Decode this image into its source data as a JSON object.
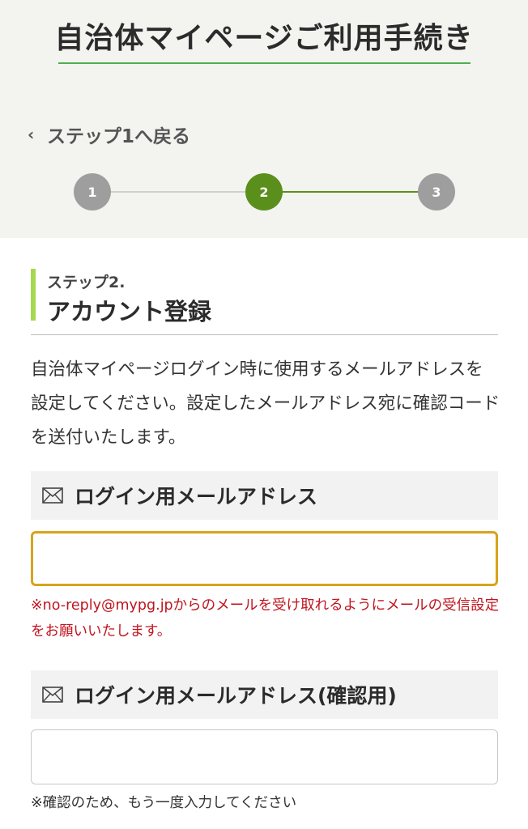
{
  "header": {
    "title": "自治体マイページご利用手続き",
    "back_link": "ステップ1へ戻る",
    "steps": [
      "1",
      "2",
      "3"
    ],
    "current_step": 2
  },
  "section": {
    "step_label": "ステップ2.",
    "title": "アカウント登録",
    "description": "自治体マイページログイン時に使用するメールアドレスを設定してください。設定したメールアドレス宛に確認コードを送付いたします。"
  },
  "email_field": {
    "label": "ログイン用メールアドレス",
    "value": "",
    "note": "※no-reply@mypg.jpからのメールを受け取れるようにメールの受信設定をお願いいたします。"
  },
  "confirm_field": {
    "label": "ログイン用メールアドレス(確認用)",
    "value": "",
    "note": "※確認のため、もう一度入力してください"
  },
  "colors": {
    "accent_green": "#5a8f1c",
    "focus_border": "#d8a31c",
    "warning_red": "#c0141e"
  }
}
